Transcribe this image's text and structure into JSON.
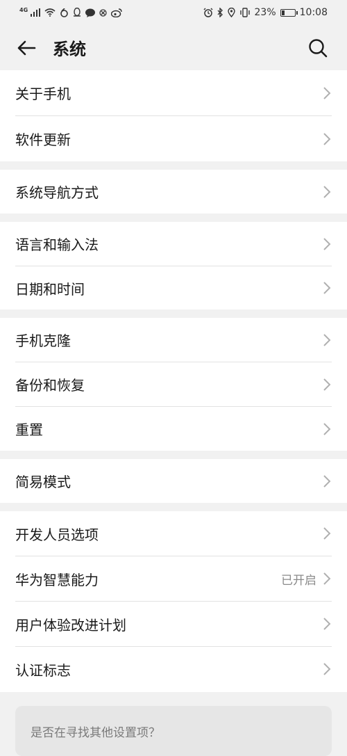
{
  "status_bar": {
    "network": "4G",
    "battery": "23%",
    "battery_level": 0.23,
    "time": "10:08",
    "icons": [
      "signal-icon",
      "wifi-icon",
      "app-icon",
      "qq-icon",
      "message-icon",
      "blocked-icon",
      "weibo-icon",
      "alarm-icon",
      "bluetooth-icon",
      "location-icon",
      "vibrate-icon",
      "battery-icon"
    ]
  },
  "header": {
    "title": "系统",
    "back_icon": "back-arrow-icon",
    "search_icon": "search-icon"
  },
  "groups": [
    {
      "items": [
        {
          "label": "关于手机"
        },
        {
          "label": "软件更新"
        }
      ]
    },
    {
      "items": [
        {
          "label": "系统导航方式"
        }
      ]
    },
    {
      "items": [
        {
          "label": "语言和输入法"
        },
        {
          "label": "日期和时间"
        }
      ]
    },
    {
      "items": [
        {
          "label": "手机克隆"
        },
        {
          "label": "备份和恢复"
        },
        {
          "label": "重置"
        }
      ]
    },
    {
      "items": [
        {
          "label": "简易模式"
        }
      ]
    },
    {
      "items": [
        {
          "label": "开发人员选项"
        },
        {
          "label": "华为智慧能力",
          "value": "已开启"
        },
        {
          "label": "用户体验改进计划"
        },
        {
          "label": "认证标志"
        }
      ]
    }
  ],
  "suggestion": {
    "text": "是否在寻找其他设置项？"
  }
}
